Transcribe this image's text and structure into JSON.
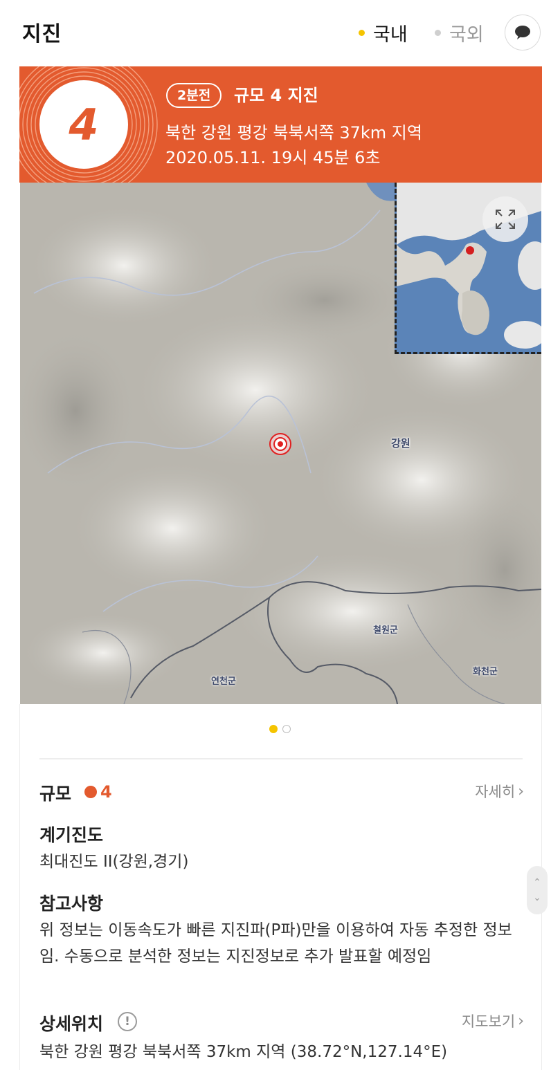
{
  "header": {
    "title": "지진",
    "tabs": [
      {
        "label": "국내",
        "active": true
      },
      {
        "label": "국외",
        "active": false
      }
    ],
    "chat_icon": "speech-bubble-icon"
  },
  "alert": {
    "magnitude": "4",
    "time_ago": "2분전",
    "headline": "규모 4 지진",
    "location": "북한 강원 평강 북북서쪽 37km 지역",
    "datetime": "2020.05.11. 19시 45분 6초",
    "color": "#e35a2e"
  },
  "map": {
    "labels": {
      "gangwon": "강원",
      "cheorwon": "철원군",
      "yeoncheon": "연천군",
      "hwacheon": "화천군"
    },
    "expand_icon": "expand-icon",
    "pages": 2,
    "current_page": 1
  },
  "details": {
    "magnitude": {
      "title": "규모",
      "value": "4",
      "link": "자세히"
    },
    "intensity": {
      "title": "계기진도",
      "value": "최대진도 II(강원,경기)"
    },
    "notes": {
      "title": "참고사항",
      "value": "위 정보는 이동속도가 빠른 지진파(P파)만을 이용하여 자동 추정한 정보임. 수동으로 분석한 정보는 지진정보로 추가 발표할 예정임"
    },
    "location": {
      "title": "상세위치",
      "link": "지도보기",
      "value": "북한 강원 평강 북북서쪽 37km 지역 (38.72°N,127.14°E)"
    }
  }
}
